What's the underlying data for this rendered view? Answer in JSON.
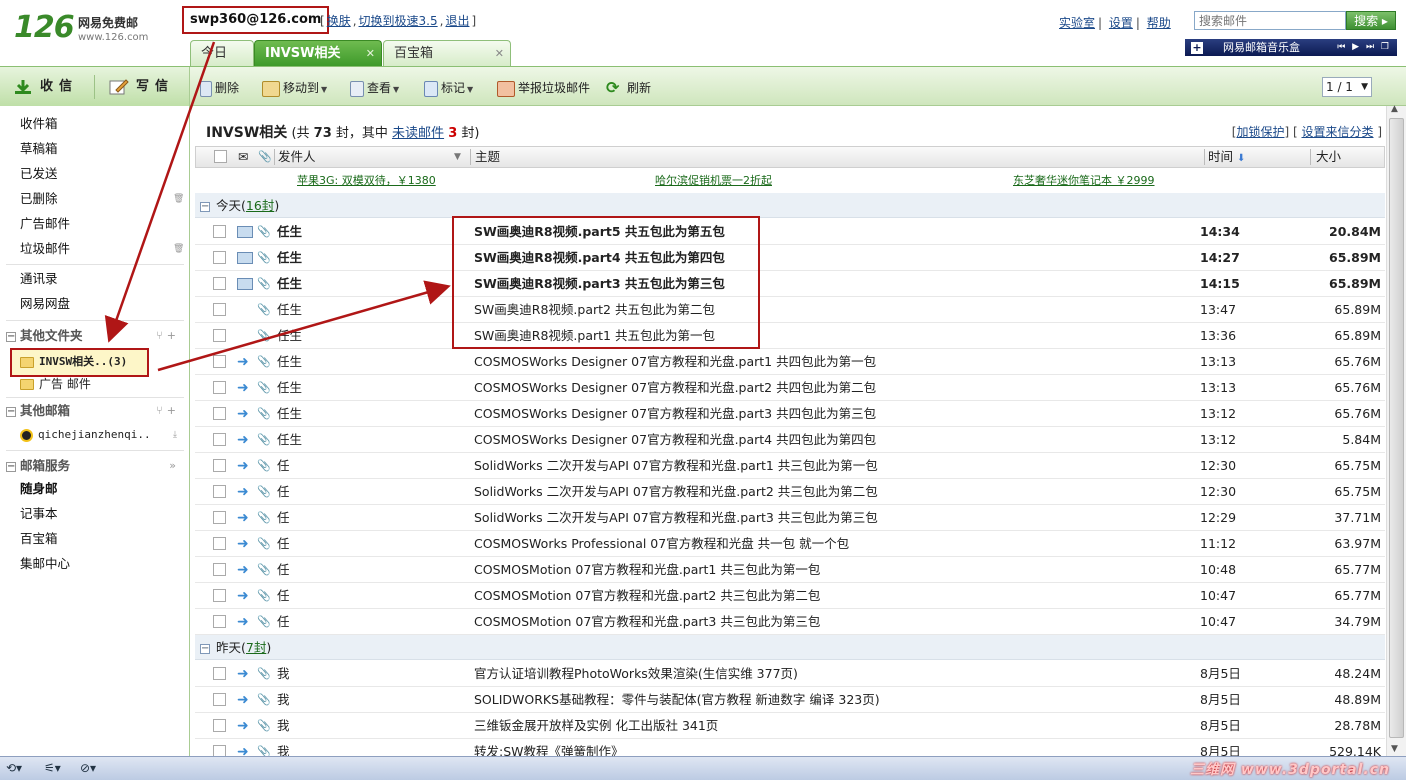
{
  "header": {
    "logo_num": "126",
    "logo_cn": "网易免费邮",
    "logo_url": "www.126.com",
    "account": "swp360@126.com",
    "acct_links": [
      "换肤",
      "切换到极速3.5",
      "退出"
    ],
    "top_links": [
      "实验室",
      "设置",
      "帮助"
    ],
    "search_placeholder": "搜索邮件",
    "search_btn": "搜索",
    "music_label": "网易邮箱音乐盒"
  },
  "tabs": [
    {
      "label": "今日"
    },
    {
      "label": "INVSW相关",
      "active": true
    },
    {
      "label": "百宝箱"
    }
  ],
  "toolbar": {
    "receive": "收信",
    "compose": "写信",
    "delete": "删除",
    "move_to": "移动到",
    "view": "查看",
    "mark": "标记",
    "report_spam": "举报垃圾邮件",
    "refresh": "刷新",
    "page": "1 / 1"
  },
  "sidebar": {
    "folders": [
      "收件箱",
      "草稿箱",
      "已发送",
      "已删除",
      "广告邮件",
      "垃圾邮件"
    ],
    "extras": [
      "通讯录",
      "网易网盘"
    ],
    "other_folders_head": "其他文件夹",
    "custom_folders": [
      {
        "label": "INVSW相关..(3)",
        "selected": true
      },
      {
        "label": "广告 邮件"
      }
    ],
    "other_mail_head": "其他邮箱",
    "other_mail": "qichejianzhenqi..",
    "services_head": "邮箱服务",
    "services": [
      "随身邮",
      "记事本",
      "百宝箱",
      "集邮中心"
    ]
  },
  "main": {
    "folder_name": "INVSW相关",
    "summary_pre": "(共",
    "total": "73",
    "summary_mid": "封，其中",
    "unread_link": "未读邮件",
    "unread": "3",
    "summary_post": "封)",
    "right_links": [
      "加锁保护",
      "设置来信分类"
    ],
    "columns": {
      "from": "发件人",
      "subject": "主题",
      "time": "时间",
      "size": "大小"
    },
    "ads": [
      "苹果3G: 双模双待，￥1380",
      "哈尔滨促销机票一2折起",
      "东芝奢华迷你笔记本 ￥2999"
    ],
    "groups": [
      {
        "label": "今天",
        "count": "16封"
      },
      {
        "label": "昨天",
        "count": "7封"
      }
    ],
    "rows_today": [
      {
        "from": "任生",
        "subject": "SW画奥迪R8视频.part5  共五包此为第五包",
        "time": "14:34",
        "size": "20.84M",
        "unread": true,
        "icon": "envelope"
      },
      {
        "from": "任生",
        "subject": "SW画奥迪R8视频.part4  共五包此为第四包",
        "time": "14:27",
        "size": "65.89M",
        "unread": true,
        "icon": "envelope"
      },
      {
        "from": "任生",
        "subject": "SW画奥迪R8视频.part3  共五包此为第三包",
        "time": "14:15",
        "size": "65.89M",
        "unread": true,
        "icon": "envelope"
      },
      {
        "from": "任生",
        "subject": "SW画奥迪R8视频.part2  共五包此为第二包",
        "time": "13:47",
        "size": "65.89M",
        "unread": false,
        "icon": "none"
      },
      {
        "from": "任生",
        "subject": "SW画奥迪R8视频.part1  共五包此为第一包",
        "time": "13:36",
        "size": "65.89M",
        "unread": false,
        "icon": "none"
      },
      {
        "from": "任生",
        "subject": "COSMOSWorks Designer 07官方教程和光盘.part1  共四包此为第一包",
        "time": "13:13",
        "size": "65.76M",
        "unread": false,
        "icon": "forward"
      },
      {
        "from": "任生",
        "subject": "COSMOSWorks Designer 07官方教程和光盘.part2  共四包此为第二包",
        "time": "13:13",
        "size": "65.76M",
        "unread": false,
        "icon": "forward"
      },
      {
        "from": "任生",
        "subject": "COSMOSWorks Designer 07官方教程和光盘.part3  共四包此为第三包",
        "time": "13:12",
        "size": "65.76M",
        "unread": false,
        "icon": "forward"
      },
      {
        "from": "任生",
        "subject": "COSMOSWorks Designer 07官方教程和光盘.part4  共四包此为第四包",
        "time": "13:12",
        "size": "5.84M",
        "unread": false,
        "icon": "forward"
      },
      {
        "from": "任",
        "subject": "SolidWorks 二次开发与API 07官方教程和光盘.part1 共三包此为第一包",
        "time": "12:30",
        "size": "65.75M",
        "unread": false,
        "icon": "forward"
      },
      {
        "from": "任",
        "subject": "SolidWorks 二次开发与API 07官方教程和光盘.part2  共三包此为第二包",
        "time": "12:30",
        "size": "65.75M",
        "unread": false,
        "icon": "forward"
      },
      {
        "from": "任",
        "subject": "SolidWorks 二次开发与API 07官方教程和光盘.part3  共三包此为第三包",
        "time": "12:29",
        "size": "37.71M",
        "unread": false,
        "icon": "forward"
      },
      {
        "from": "任",
        "subject": "COSMOSWorks Professional  07官方教程和光盘  共一包 就一个包",
        "time": "11:12",
        "size": "63.97M",
        "unread": false,
        "icon": "forward"
      },
      {
        "from": "任",
        "subject": "COSMOSMotion 07官方教程和光盘.part1  共三包此为第一包",
        "time": "10:48",
        "size": "65.77M",
        "unread": false,
        "icon": "forward"
      },
      {
        "from": "任",
        "subject": "COSMOSMotion 07官方教程和光盘.part2  共三包此为第二包",
        "time": "10:47",
        "size": "65.77M",
        "unread": false,
        "icon": "forward"
      },
      {
        "from": "任",
        "subject": "COSMOSMotion 07官方教程和光盘.part3  共三包此为第三包",
        "time": "10:47",
        "size": "34.79M",
        "unread": false,
        "icon": "forward"
      }
    ],
    "rows_yesterday": [
      {
        "from": "我",
        "subject": "官方认证培训教程PhotoWorks效果渲染(生信实维 377页)",
        "time": "8月5日",
        "size": "48.24M",
        "icon": "forward"
      },
      {
        "from": "我",
        "subject": "SOLIDWORKS基础教程：零件与装配体(官方教程 新迪数字 编译 323页)",
        "time": "8月5日",
        "size": "48.89M",
        "icon": "forward"
      },
      {
        "from": "我",
        "subject": "三维钣金展开放样及实例 化工出版社 341页",
        "time": "8月5日",
        "size": "28.78M",
        "icon": "forward"
      },
      {
        "from": "我",
        "subject": "转发:SW教程《弹簧制作》",
        "time": "8月5日",
        "size": "529.14K",
        "icon": "forward"
      }
    ]
  },
  "statusbar": {
    "watermark": "三维网 www.3dportal.cn"
  },
  "colors": {
    "accent_green": "#3e9a2a",
    "annotation_red": "#b01616",
    "link_blue": "#1c4a8a"
  }
}
